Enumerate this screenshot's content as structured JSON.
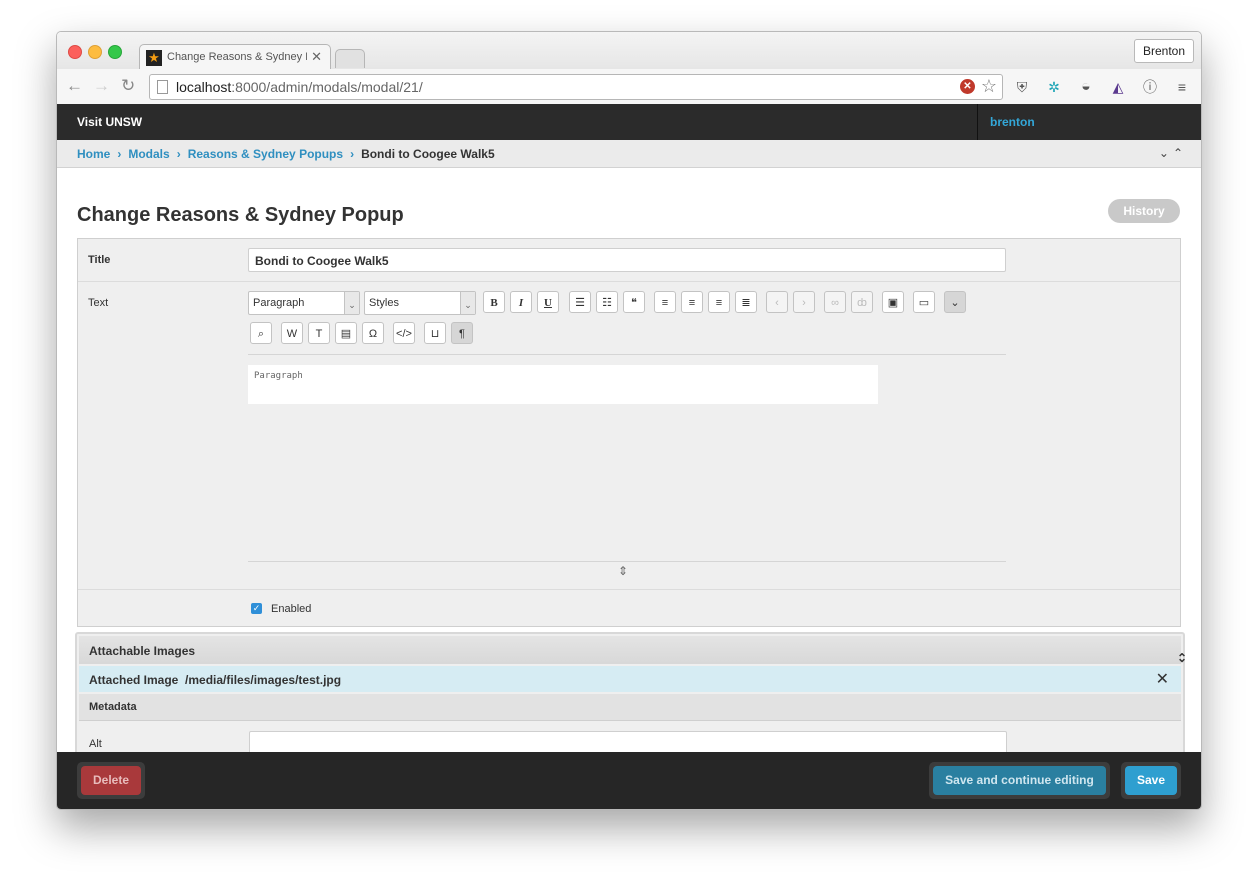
{
  "browser": {
    "tab_title": "Change Reasons & Sydney Popup",
    "profile_name": "Brenton",
    "url_host": "localhost",
    "url_path": ":8000/admin/modals/modal/21/"
  },
  "admin": {
    "brand": "Visit UNSW",
    "user": "brenton"
  },
  "breadcrumbs": {
    "home": "Home",
    "modals": "Modals",
    "section": "Reasons & Sydney Popups",
    "current": "Bondi to Coogee Walk5"
  },
  "page": {
    "title": "Change Reasons & Sydney Popup",
    "history_label": "History"
  },
  "form": {
    "title_label": "Title",
    "title_value": "Bondi to Coogee Walk5",
    "text_label": "Text",
    "format_select": "Paragraph",
    "styles_select": "Styles",
    "editor_status": "Paragraph",
    "enabled_label": "Enabled",
    "enabled_checked": true
  },
  "inline": {
    "header": "Attachable Images",
    "attached_label": "Attached Image",
    "attached_path": "/media/files/images/test.jpg",
    "metadata_label": "Metadata",
    "alt_label": "Alt"
  },
  "footer": {
    "delete_label": "Delete",
    "save_continue_label": "Save and continue editing",
    "save_label": "Save"
  },
  "colors": {
    "link": "#2f8fc0",
    "header_bg": "#2b2b2b",
    "delete": "#a9393b",
    "save": "#2e9fd0"
  }
}
